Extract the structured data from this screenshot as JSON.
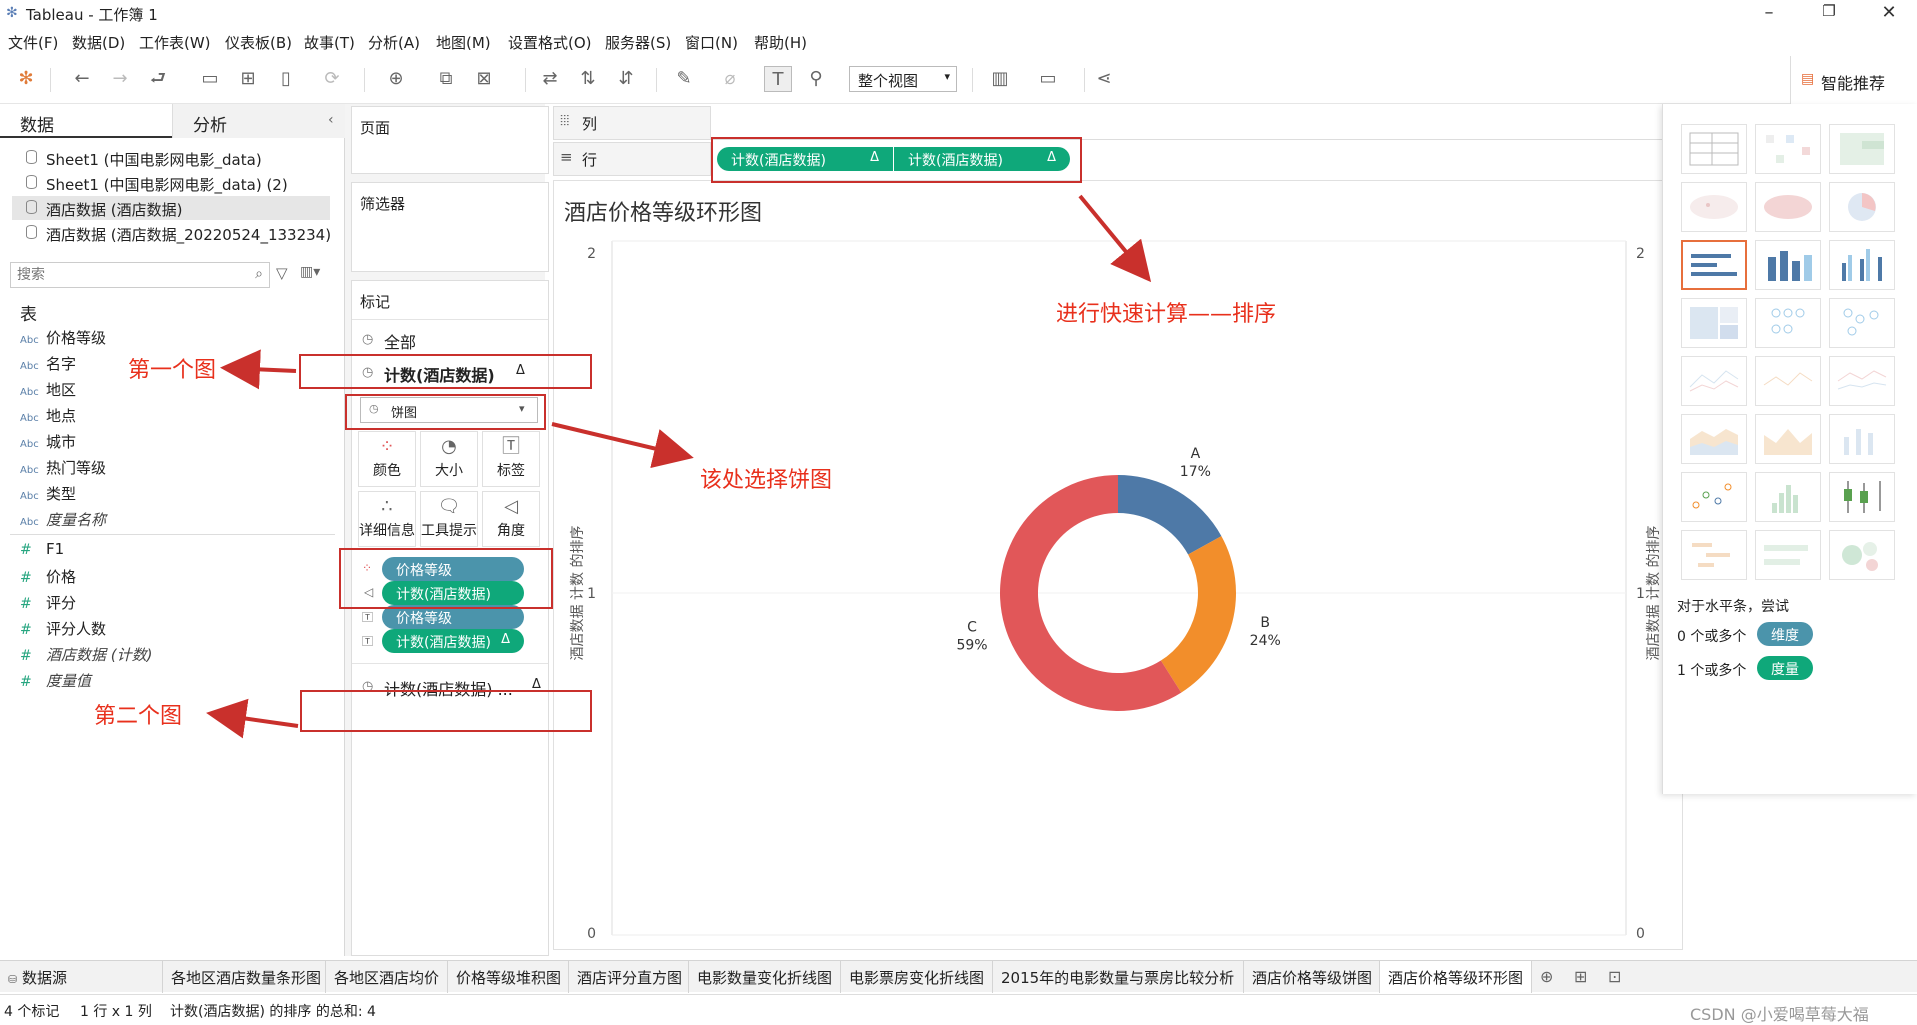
{
  "window": {
    "title": "Tableau - 工作簿 1",
    "minimize": "–",
    "restore": "❐",
    "close": "✕"
  },
  "menu": [
    "文件(F)",
    "数据(D)",
    "工作表(W)",
    "仪表板(B)",
    "故事(T)",
    "分析(A)",
    "地图(M)",
    "设置格式(O)",
    "服务器(S)",
    "窗口(N)",
    "帮助(H)"
  ],
  "toolbar": {
    "view_select": "整个视图",
    "smart_recommend": "智能推荐"
  },
  "left_pane": {
    "tab_data": "数据",
    "tab_analysis": "分析",
    "datasources": [
      "Sheet1 (中国电影网电影_data)",
      "Sheet1 (中国电影网电影_data) (2)",
      "酒店数据 (酒店数据)",
      "酒店数据 (酒店数据_20220524_133234)"
    ],
    "search_placeholder": "搜索",
    "tables_header": "表",
    "dimensions": [
      "价格等级",
      "名字",
      "地区",
      "地点",
      "城市",
      "热门等级",
      "类型",
      "度量名称"
    ],
    "measures": [
      "F1",
      "价格",
      "评分",
      "评分人数",
      "酒店数据 (计数)",
      "度量值"
    ],
    "abc": "Abc",
    "hash": "#"
  },
  "mid_pane": {
    "pages": "页面",
    "filters": "筛选器",
    "marks": "标记",
    "all": "全部",
    "marks_layer1": "计数(酒店数据)",
    "mark_type": "饼图",
    "buttons": {
      "color": "颜色",
      "size": "大小",
      "label": "标签",
      "detail": "详细信息",
      "tooltip": "工具提示",
      "angle": "角度"
    },
    "mark_pills": [
      "价格等级",
      "计数(酒店数据)",
      "价格等级",
      "计数(酒店数据)"
    ],
    "marks_layer2": "计数(酒店数据) ...",
    "delta": "Δ"
  },
  "shelves": {
    "columns": "列",
    "rows": "行",
    "row_pills": [
      "计数(酒店数据)",
      "计数(酒店数据)"
    ]
  },
  "viz": {
    "title": "酒店价格等级环形图",
    "y_axis_label": "酒店数据 计数 的排序",
    "y_ticks": [
      "2",
      "1",
      "0"
    ]
  },
  "chart_data": {
    "type": "pie",
    "title": "酒店价格等级环形图",
    "categories": [
      "A",
      "B",
      "C"
    ],
    "values": [
      17,
      24,
      59
    ],
    "labels": [
      "17%",
      "24%",
      "59%"
    ],
    "colors": [
      "#4e79a7",
      "#f28e2b",
      "#e15759"
    ],
    "donut": true,
    "ylabel": "酒店数据 计数 的排序",
    "ylim": [
      0,
      2
    ]
  },
  "smart_pane": {
    "hint": "对于水平条，尝试",
    "dim_prefix": "0 个或多个",
    "dim_pill": "维度",
    "mea_prefix": "1 个或多个",
    "mea_pill": "度量"
  },
  "annotations": {
    "first_chart": "第一个图",
    "second_chart": "第二个图",
    "choose_pie": "该处选择饼图",
    "quick_calc": "进行快速计算——排序"
  },
  "bottom_tabs": [
    "数据源",
    "各地区酒店数量条形图",
    "各地区酒店均价",
    "价格等级堆积图",
    "酒店评分直方图",
    "电影数量变化折线图",
    "电影票房变化折线图",
    "2015年的电影数量与票房比较分析",
    "酒店价格等级饼图",
    "酒店价格等级环形图"
  ],
  "status": {
    "marks": "4 个标记",
    "rows_cols": "1 行 x 1 列",
    "sum": "计数(酒店数据) 的排序 的总和: 4",
    "watermark": "CSDN @小爱喝草莓大福"
  }
}
